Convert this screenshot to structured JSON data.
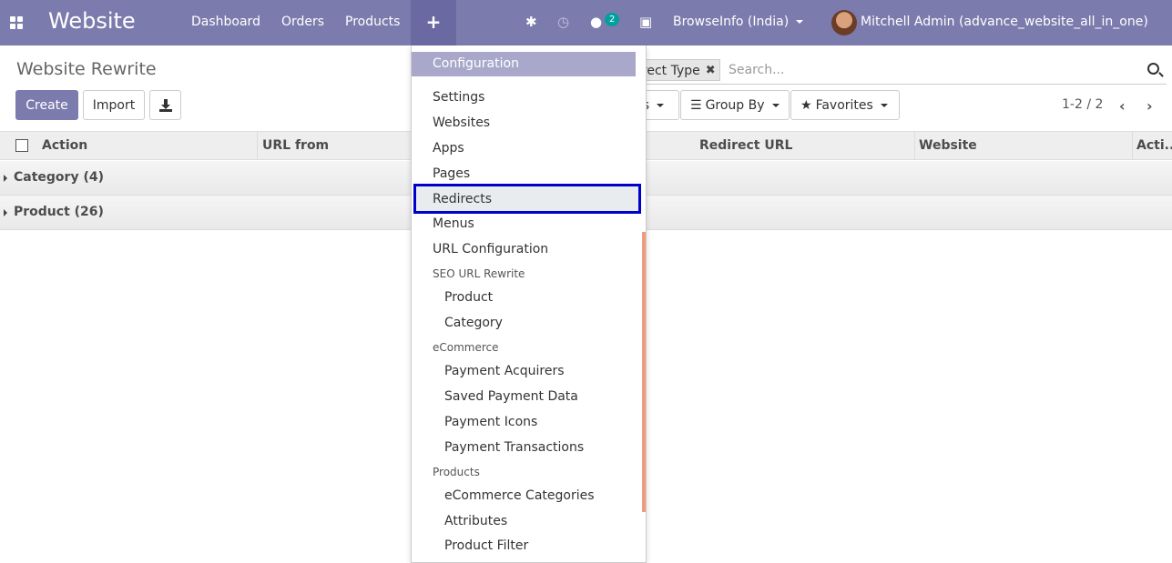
{
  "navbar": {
    "brand": "Website",
    "menu": [
      "Dashboard",
      "Orders",
      "Products"
    ],
    "plus_label": "+",
    "chat_badge": "2",
    "company": "BrowseInfo (India)",
    "user": "Mitchell Admin (advance_website_all_in_one)"
  },
  "control": {
    "title": "Website Rewrite",
    "create_label": "Create",
    "import_label": "Import",
    "facet_label": "irect Type",
    "search_placeholder": "Search...",
    "filters_label": "rs",
    "groupby_label": "Group By",
    "favorites_label": "Favorites",
    "pager": "1-2 / 2"
  },
  "list": {
    "columns": [
      "Action",
      "URL from",
      "Redirect URL",
      "Website",
      "Acti..."
    ],
    "groups": [
      "Category (4)",
      "Product (26)"
    ]
  },
  "dropdown": {
    "header": "Configuration",
    "items": [
      "Settings",
      "Websites",
      "Apps",
      "Pages",
      "Redirects",
      "Menus",
      "URL Configuration"
    ],
    "group1": "SEO URL Rewrite",
    "group1_items": [
      "Product",
      "Category"
    ],
    "group2": "eCommerce",
    "group2_items": [
      "Payment Acquirers",
      "Saved Payment Data",
      "Payment Icons",
      "Payment Transactions"
    ],
    "group3": "Products",
    "group3_items": [
      "eCommerce Categories",
      "Attributes",
      "Product Filter"
    ]
  },
  "colors": {
    "navbar": "#7c7bad",
    "highlight_border": "#0000cc",
    "badge": "#00a09d"
  }
}
